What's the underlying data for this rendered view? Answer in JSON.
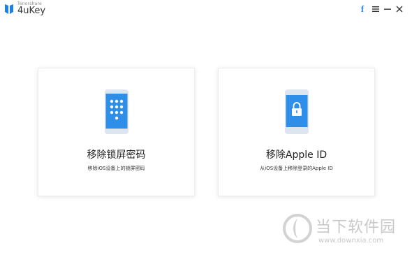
{
  "app": {
    "brand_small": "Tenorshare",
    "brand_name": "4uKey"
  },
  "toolbar": {
    "facebook_label": "f"
  },
  "cards": [
    {
      "title": "移除锁屏密码",
      "subtitle": "移除iOS设备上的锁屏密码",
      "icon": "phone-keypad-icon"
    },
    {
      "title": "移除Apple ID",
      "subtitle": "从iOS设备上移除登录的Apple ID",
      "icon": "phone-lock-icon"
    }
  ],
  "watermark": {
    "text": "当下软件园",
    "url": "www.downxia.com"
  },
  "colors": {
    "accent": "#2f8ee8",
    "phone_body": "#dde6ef",
    "background": "#ffffff"
  }
}
